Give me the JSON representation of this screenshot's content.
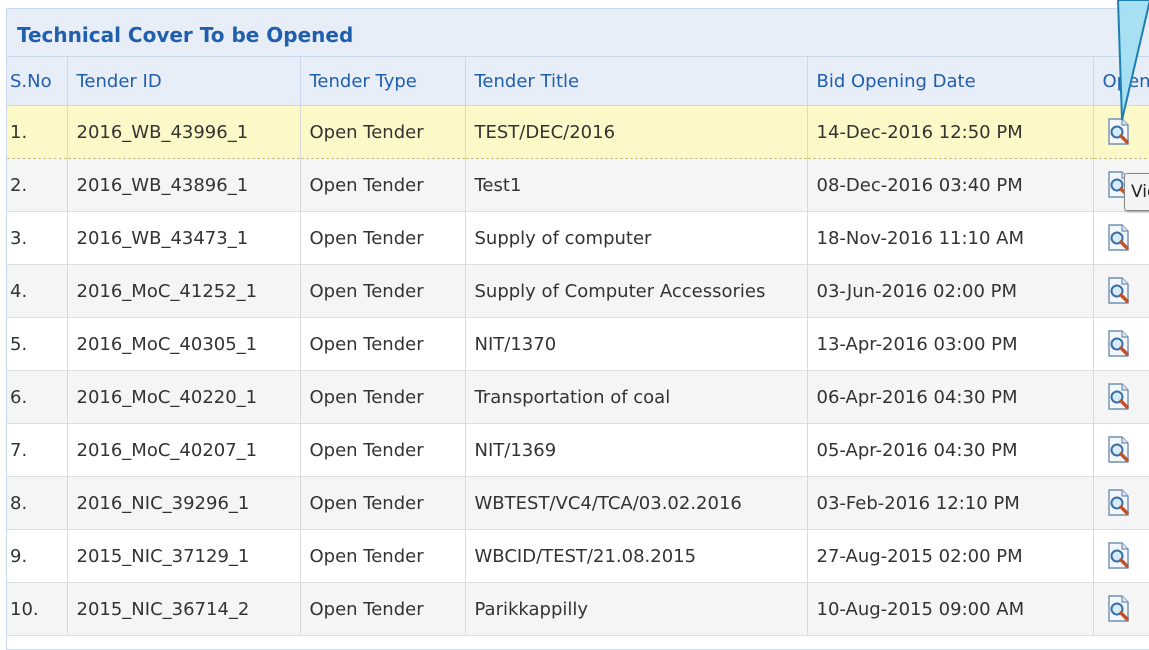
{
  "panel": {
    "title": "Technical Cover To be Opened"
  },
  "table": {
    "headers": {
      "sno": "S.No",
      "tender_id": "Tender ID",
      "tender_type": "Tender Type",
      "tender_title": "Tender Title",
      "bid_opening_date": "Bid Opening Date",
      "open": "Open"
    },
    "rows": [
      {
        "sno": "1.",
        "tender_id": "2016_WB_43996_1",
        "tender_type": "Open Tender",
        "tender_title": "TEST/DEC/2016",
        "bid_opening_date": "14-Dec-2016 12:50 PM"
      },
      {
        "sno": "2.",
        "tender_id": "2016_WB_43896_1",
        "tender_type": "Open Tender",
        "tender_title": "Test1",
        "bid_opening_date": "08-Dec-2016 03:40 PM"
      },
      {
        "sno": "3.",
        "tender_id": "2016_WB_43473_1",
        "tender_type": "Open Tender",
        "tender_title": "Supply of computer",
        "bid_opening_date": "18-Nov-2016 11:10 AM"
      },
      {
        "sno": "4.",
        "tender_id": "2016_MoC_41252_1",
        "tender_type": "Open Tender",
        "tender_title": "Supply of Computer Accessories",
        "bid_opening_date": "03-Jun-2016 02:00 PM"
      },
      {
        "sno": "5.",
        "tender_id": "2016_MoC_40305_1",
        "tender_type": "Open Tender",
        "tender_title": "NIT/1370",
        "bid_opening_date": "13-Apr-2016 03:00 PM"
      },
      {
        "sno": "6.",
        "tender_id": "2016_MoC_40220_1",
        "tender_type": "Open Tender",
        "tender_title": "Transportation of coal",
        "bid_opening_date": "06-Apr-2016 04:30 PM"
      },
      {
        "sno": "7.",
        "tender_id": "2016_MoC_40207_1",
        "tender_type": "Open Tender",
        "tender_title": "NIT/1369",
        "bid_opening_date": "05-Apr-2016 04:30 PM"
      },
      {
        "sno": "8.",
        "tender_id": "2016_NIC_39296_1",
        "tender_type": "Open Tender",
        "tender_title": "WBTEST/VC4/TCA/03.02.2016",
        "bid_opening_date": "03-Feb-2016 12:10 PM"
      },
      {
        "sno": "9.",
        "tender_id": "2015_NIC_37129_1",
        "tender_type": "Open Tender",
        "tender_title": "WBCID/TEST/21.08.2015",
        "bid_opening_date": "27-Aug-2015 02:00 PM"
      },
      {
        "sno": "10.",
        "tender_id": "2015_NIC_36714_2",
        "tender_type": "Open Tender",
        "tender_title": "Parikkappilly",
        "bid_opening_date": "10-Aug-2015 09:00 AM"
      }
    ]
  },
  "tooltip": {
    "text": "View"
  },
  "icons": {
    "open_action": "view-document-icon"
  },
  "colors": {
    "header_text": "#1f5fae",
    "header_bg": "#e8eef8",
    "highlight_row": "#fcf8c8",
    "pointer_fill": "#a6e0f2"
  }
}
